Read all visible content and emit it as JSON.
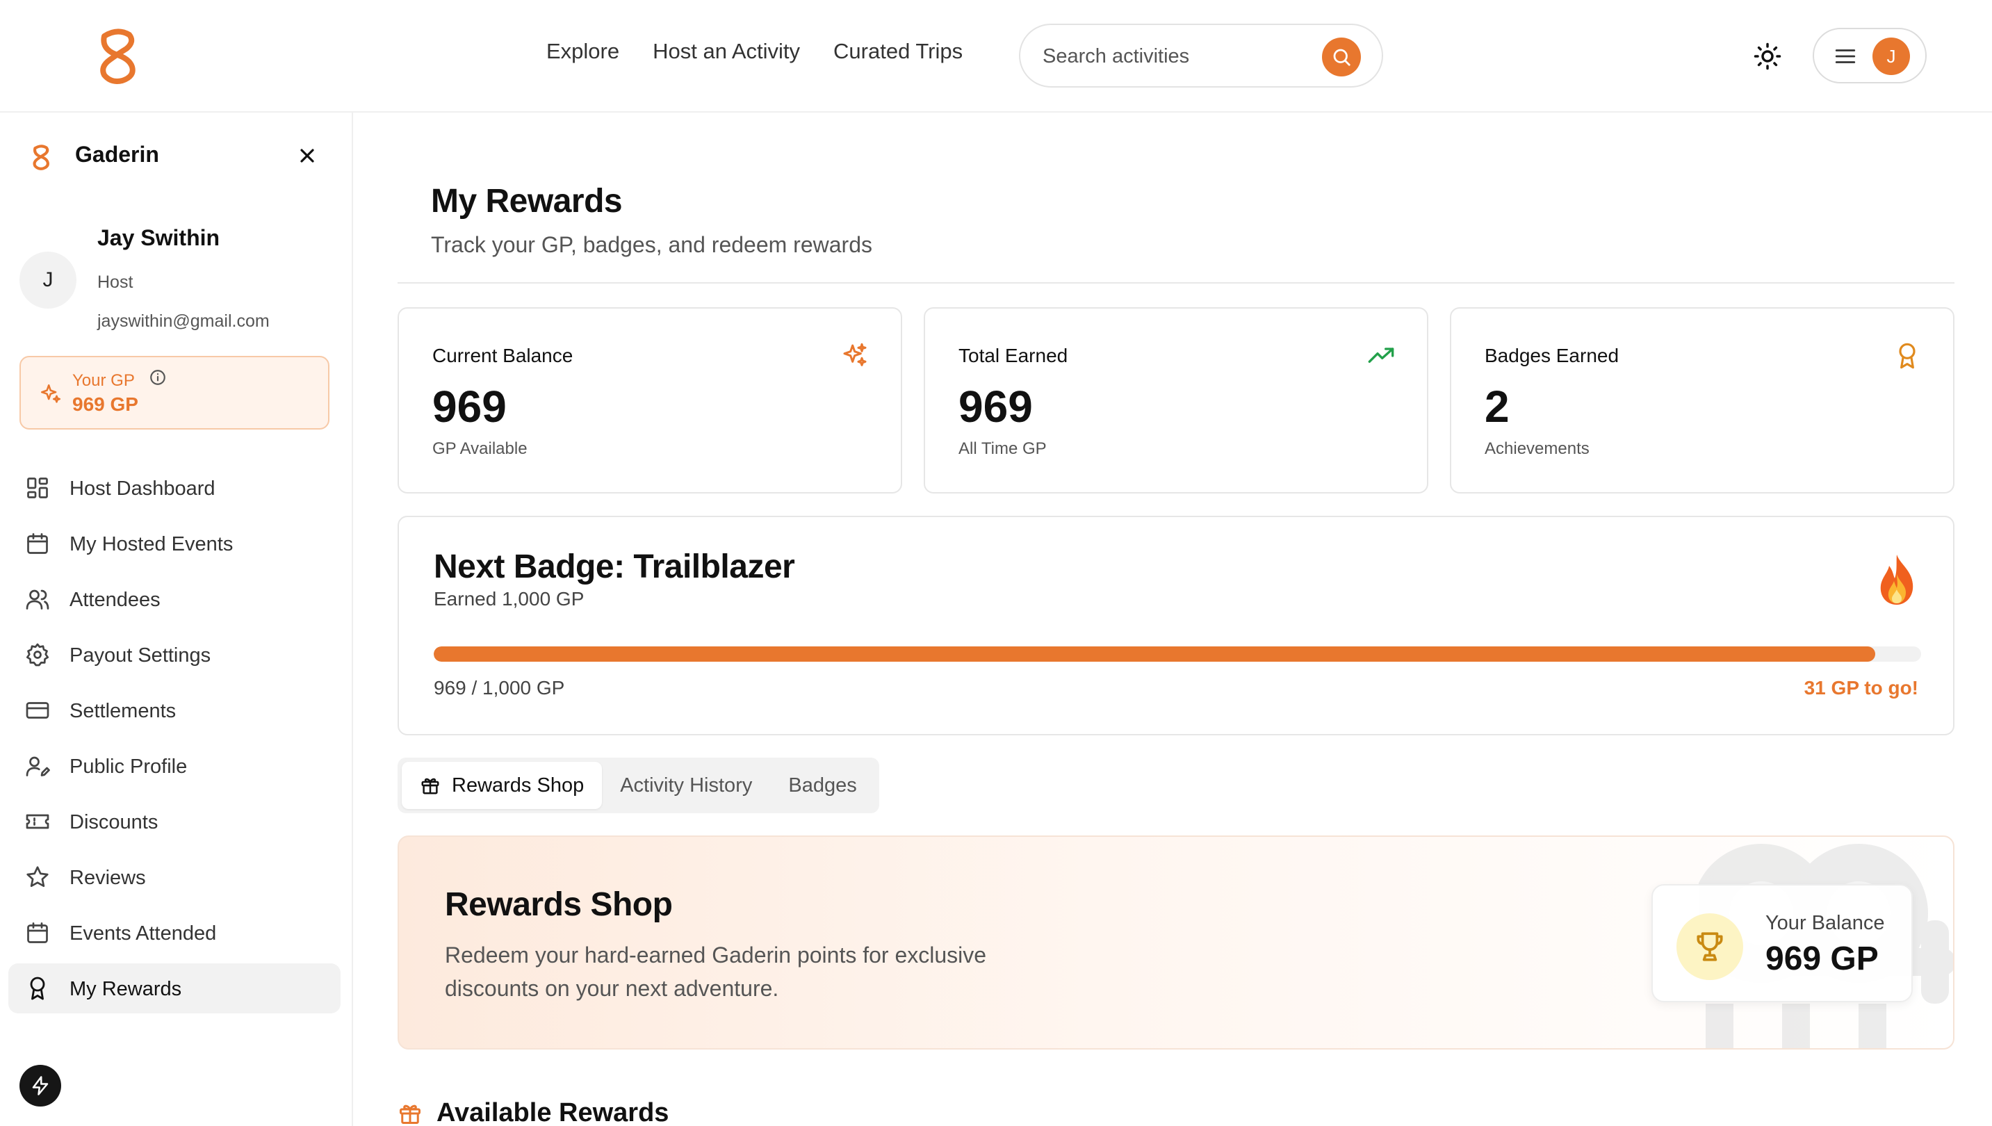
{
  "colors": {
    "accent": "#e8772e",
    "accent_soft": "#fff3eb",
    "text": "#111111",
    "muted": "#555555"
  },
  "topbar": {
    "nav": [
      "Explore",
      "Host an Activity",
      "Curated Trips"
    ],
    "search": {
      "placeholder": "Search activities",
      "value": ""
    },
    "user_initial": "J"
  },
  "sidebar": {
    "brand": "Gaderin",
    "user": {
      "initial": "J",
      "name": "Jay Swithin",
      "role": "Host",
      "email": "jayswithin@gmail.com"
    },
    "gp": {
      "label": "Your GP",
      "value": "969 GP"
    },
    "items": [
      {
        "label": "Host Dashboard",
        "icon": "dashboard-icon"
      },
      {
        "label": "My Hosted Events",
        "icon": "calendar-icon"
      },
      {
        "label": "Attendees",
        "icon": "users-icon"
      },
      {
        "label": "Payout Settings",
        "icon": "gear-icon"
      },
      {
        "label": "Settlements",
        "icon": "credit-card-icon"
      },
      {
        "label": "Public Profile",
        "icon": "user-edit-icon"
      },
      {
        "label": "Discounts",
        "icon": "ticket-icon"
      },
      {
        "label": "Reviews",
        "icon": "star-icon"
      },
      {
        "label": "Events Attended",
        "icon": "calendar-icon"
      },
      {
        "label": "My Rewards",
        "icon": "award-icon",
        "active": true
      }
    ]
  },
  "main": {
    "title": "My Rewards",
    "subtitle": "Track your GP, badges, and redeem rewards",
    "stats": [
      {
        "label": "Current Balance",
        "value": "969",
        "sub": "GP Available",
        "icon": "sparkles-icon"
      },
      {
        "label": "Total Earned",
        "value": "969",
        "sub": "All Time GP",
        "icon": "trending-up-icon"
      },
      {
        "label": "Badges Earned",
        "value": "2",
        "sub": "Achievements",
        "icon": "award-icon"
      }
    ],
    "next_badge": {
      "title": "Next Badge: Trailblazer",
      "subtitle": "Earned 1,000 GP",
      "icon": "flame-icon",
      "current": 969,
      "target": 1000,
      "progress_text": "969 / 1,000 GP",
      "remaining_text": "31 GP to go!"
    },
    "tabs": [
      {
        "label": "Rewards Shop",
        "active": true,
        "icon": "gift-icon"
      },
      {
        "label": "Activity History",
        "active": false
      },
      {
        "label": "Badges",
        "active": false
      }
    ],
    "shop": {
      "title": "Rewards Shop",
      "description": "Redeem your hard-earned Gaderin points for exclusive discounts on your next adventure.",
      "balance_label": "Your Balance",
      "balance_value": "969 GP"
    },
    "available_rewards_title": "Available Rewards"
  }
}
